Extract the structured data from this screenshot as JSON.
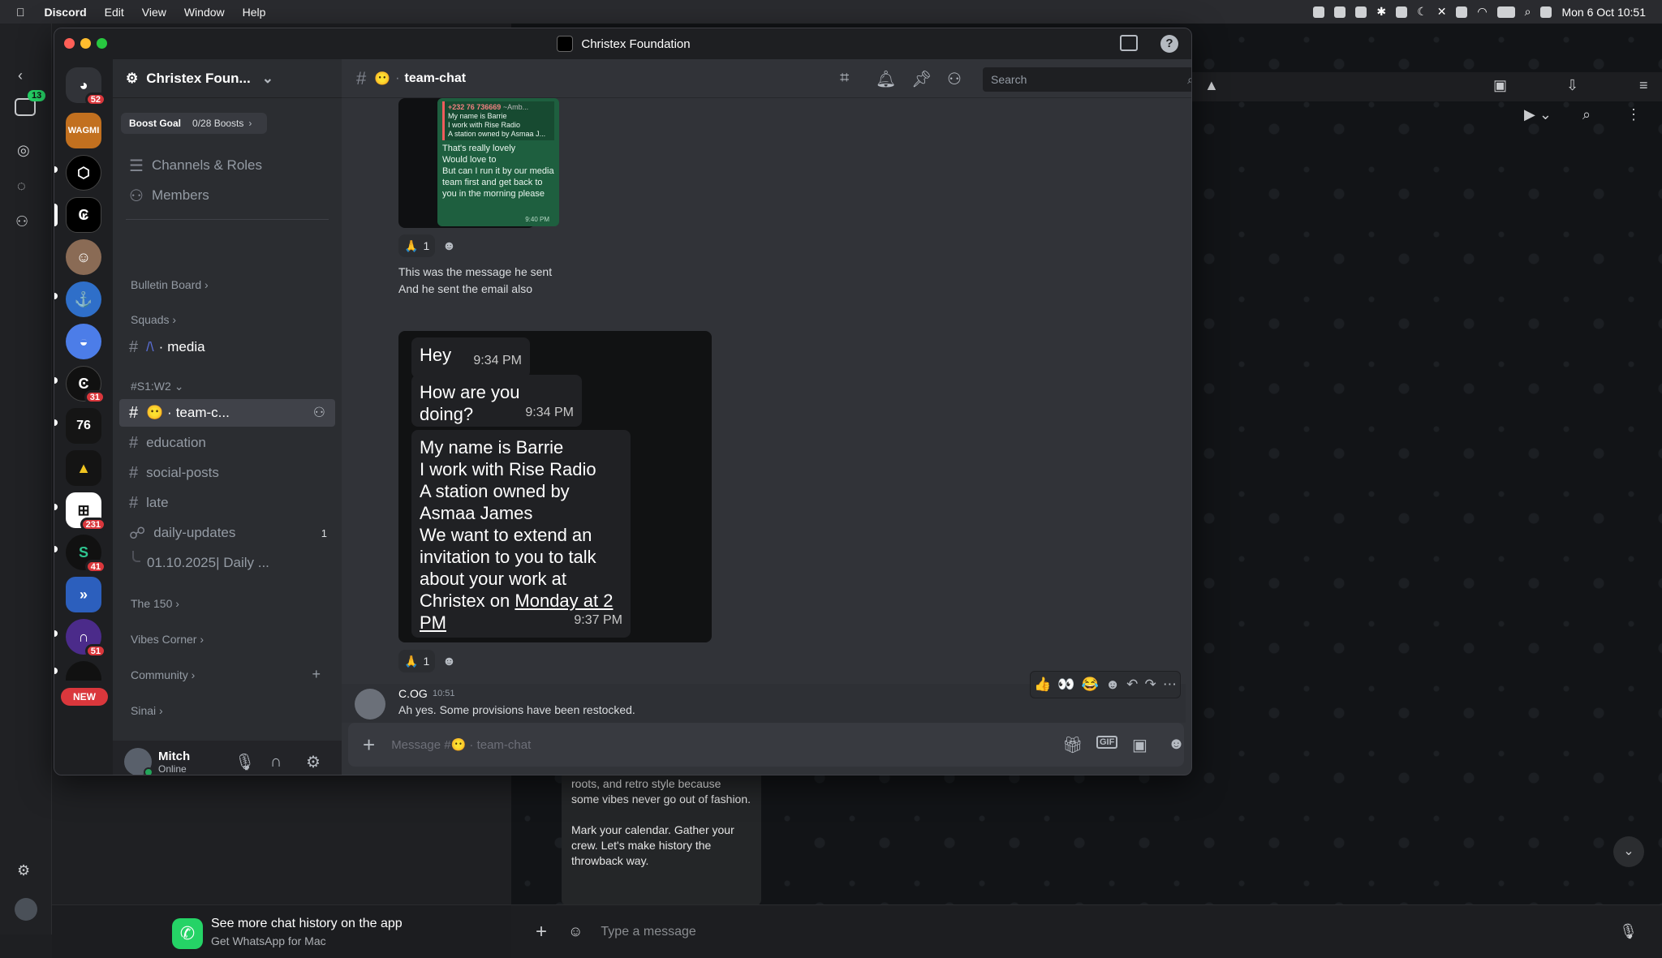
{
  "menubar": {
    "apple": "",
    "app": "Discord",
    "items": [
      "Edit",
      "View",
      "Window",
      "Help"
    ],
    "datetime": "Mon 6 Oct  10:51"
  },
  "whatsapp": {
    "rail_badge": "13",
    "banner_title": "See more chat history on the app",
    "banner_sub": "Get WhatsApp for Mac",
    "bubble_text": "roots, and retro style because some vibes never go out of fashion.\n\nMark your calendar. Gather your crew. Let's make history the throwback way.",
    "input_placeholder": "Type a message"
  },
  "discord": {
    "window_title": "Christex Foundation",
    "server_name": "Christex Foun...",
    "boost": {
      "label": "Boost Goal",
      "count": "0/28 Boosts"
    },
    "servers": [
      {
        "badge": "52"
      },
      {
        "badge": ""
      },
      {
        "badge": ""
      },
      {
        "badge": ""
      },
      {
        "badge": ""
      },
      {
        "badge": ""
      },
      {
        "badge": ""
      },
      {
        "badge": "31"
      },
      {
        "badge": ""
      },
      {
        "badge": ""
      },
      {
        "badge": "231"
      },
      {
        "badge": "41"
      },
      {
        "badge": ""
      },
      {
        "badge": "51"
      },
      {
        "badge": ""
      }
    ],
    "new_label": "NEW",
    "nav": {
      "channels_roles": "Channels & Roles",
      "members": "Members"
    },
    "categories": {
      "bulletin": "Bulletin Board",
      "squads": "Squads",
      "s1w2": "#S1:W2",
      "the150": "The 150",
      "vibes": "Vibes Corner",
      "community": "Community",
      "sinai": "Sinai"
    },
    "channels": {
      "media": "media",
      "team_chat": "team-c...",
      "education": "education",
      "social_posts": "social-posts",
      "late": "late",
      "daily_updates": "daily-updates",
      "daily_updates_count": "1",
      "thread": "01.10.2025| Daily ..."
    },
    "user": {
      "name": "Mitch",
      "status": "Online"
    },
    "chat": {
      "channel": "team-chat",
      "search_placeholder": "Search",
      "composer_placeholder": "Message #😶 · team-chat"
    },
    "messages": {
      "screenshot1": {
        "phone": "+232 76 736669",
        "sender": "~Amb...",
        "quote": [
          "My name is Barrie",
          "I work with Rise Radio",
          "A station owned by Asmaa J..."
        ],
        "body": "That's really lovely\nWould love to\nBut can I run it by our media team first and get back to you in the morning please",
        "time": "9:40 PM"
      },
      "reaction1": {
        "emoji": "🙏",
        "count": "1"
      },
      "text1": "This was the message he sent",
      "text2": "And he sent the email also",
      "bubble_hey": {
        "text": "Hey",
        "time": "9:34 PM"
      },
      "bubble_how": {
        "text": "How are you doing?",
        "time": "9:34 PM"
      },
      "bubble_long": {
        "text": "My name is Barrie\nI work with Rise Radio\nA station owned by\nAsmaa James\nWe want to extend an\ninvitation to you to talk\nabout your work at\nChristex on ",
        "link": "Monday at 2 PM",
        "time": "9:37 PM"
      },
      "reaction2": {
        "emoji": "🙏",
        "count": "1"
      },
      "last": {
        "author": "C.OG",
        "time": "10:51",
        "text": "Ah yes. Some provisions have been restocked."
      }
    },
    "hover_reactions": [
      "👍",
      "👀",
      "😂"
    ]
  }
}
